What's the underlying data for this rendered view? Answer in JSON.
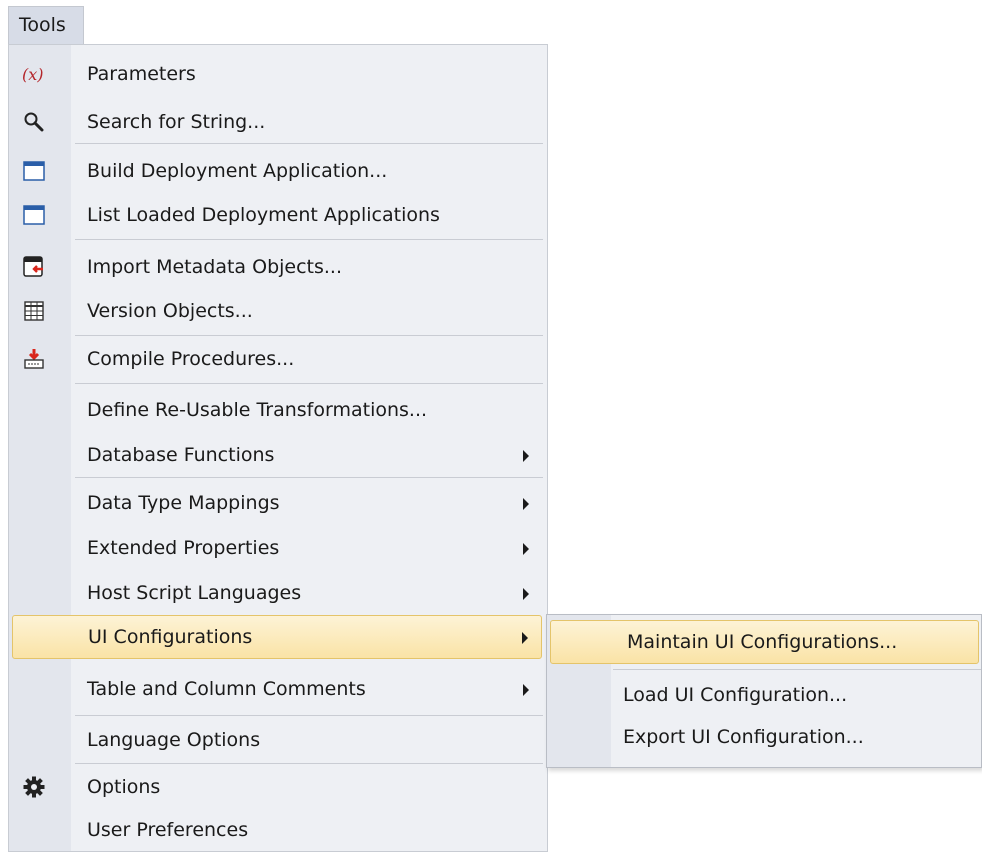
{
  "menubar": {
    "title": "Tools"
  },
  "menu": {
    "items": [
      {
        "label": "Parameters",
        "icon": "parameters-icon"
      },
      {
        "label": "Search for String...",
        "icon": "search-icon"
      },
      {
        "label": "Build Deployment Application...",
        "icon": "window-icon"
      },
      {
        "label": "List Loaded Deployment Applications",
        "icon": "window-icon"
      },
      {
        "label": "Import Metadata Objects...",
        "icon": "import-icon"
      },
      {
        "label": "Version Objects...",
        "icon": "grid-icon"
      },
      {
        "label": "Compile Procedures...",
        "icon": "compile-icon"
      },
      {
        "label": "Define Re-Usable Transformations..."
      },
      {
        "label": "Database Functions",
        "submenu": true
      },
      {
        "label": "Data Type Mappings",
        "submenu": true
      },
      {
        "label": "Extended Properties",
        "submenu": true
      },
      {
        "label": "Host Script Languages",
        "submenu": true
      },
      {
        "label": "UI Configurations",
        "submenu": true,
        "highlighted": true
      },
      {
        "label": "Table and Column Comments",
        "submenu": true
      },
      {
        "label": "Language Options"
      },
      {
        "label": "Options",
        "icon": "gear-icon"
      },
      {
        "label": "User Preferences"
      }
    ]
  },
  "submenu": {
    "items": [
      {
        "label": "Maintain UI Configurations...",
        "highlighted": true
      },
      {
        "label": "Load UI Configuration..."
      },
      {
        "label": "Export UI Configuration..."
      }
    ]
  },
  "colors": {
    "highlight_top": "#fdf3d6",
    "highlight_bottom": "#fae3a6",
    "highlight_border": "#e4c46a",
    "menu_bg": "#eef0f4",
    "gutter_bg": "#e3e6ed",
    "parameters_red": "#b4262b",
    "icon_blue": "#2a5ea8",
    "icon_red": "#d9261c"
  }
}
